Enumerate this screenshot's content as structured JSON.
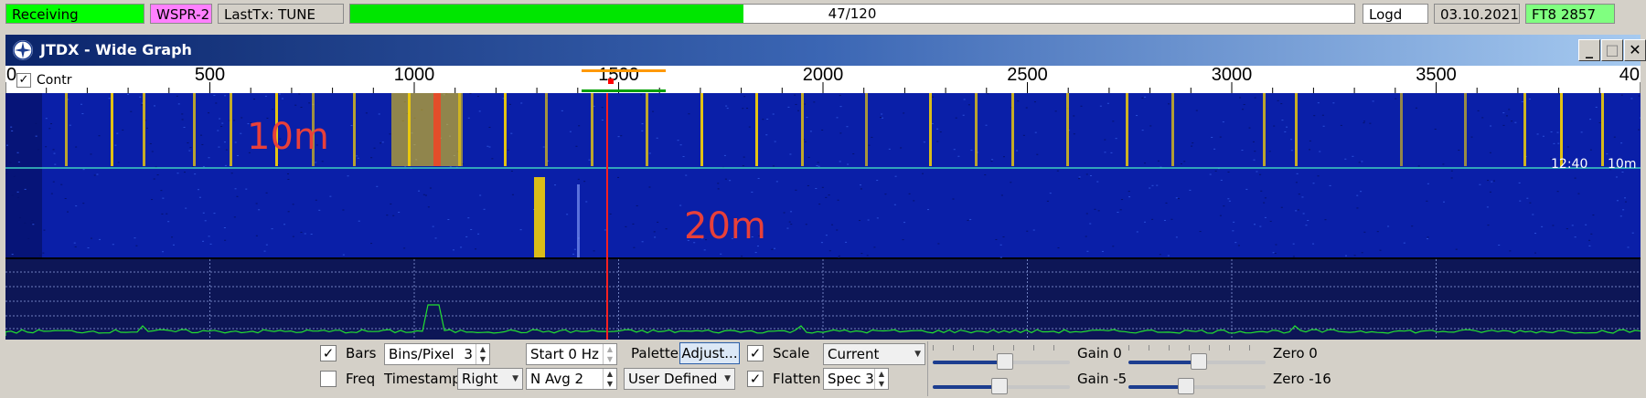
{
  "status": {
    "receiving": "Receiving",
    "mode": "WSPR-2",
    "last_tx": "LastTx: TUNE",
    "progress_label": "47/120",
    "progress_fraction": 0.3917,
    "logd": "Logd",
    "date": "03.10.2021",
    "ft8": "FT8  2857"
  },
  "window": {
    "title": "JTDX - Wide Graph",
    "minimize": "_",
    "maximize": "□",
    "close": "✕"
  },
  "ruler": {
    "control_label": "Contr",
    "control_checked": "✓",
    "ticks": [
      "0",
      "500",
      "1000",
      "1500",
      "2000",
      "2500",
      "3000",
      "3500",
      "40"
    ]
  },
  "waterfall": {
    "annotations": [
      "10m",
      "20m"
    ],
    "timestamp": "12:40",
    "band_label": "10m"
  },
  "controls": {
    "bars_label": "Bars",
    "bars_checked": "✓",
    "freq_label": "Freq",
    "freq_checked": "",
    "bins_label": "Bins/Pixel",
    "bins_value": "3",
    "timestamp_label": "Timestamp",
    "timestamp_value": "Right",
    "start_value": "Start 0 Hz",
    "navg_value": "N Avg 2",
    "palette_label": "Palette",
    "adjust_button": "Adjust...",
    "palette_value": "User Defined",
    "scale_checked": "✓",
    "scale_label": "Scale",
    "scale_value": "Current",
    "flatten_checked": "✓",
    "flatten_label": "Flatten",
    "spec_value": "Spec 3",
    "gain1_label": "Gain 0",
    "gain2_label": "Gain -5",
    "zero1_label": "Zero 0",
    "zero2_label": "Zero -16"
  },
  "colors": {
    "receiving_bg": "#00ff00",
    "mode_bg": "#ff80ff",
    "progress_fill": "#00e600",
    "ft8_bg": "#80ff80",
    "waterfall_bg": "#0a1fa8",
    "signal": "#ffd800",
    "annotation": "#e8403a",
    "cursor": "#ff2020"
  }
}
